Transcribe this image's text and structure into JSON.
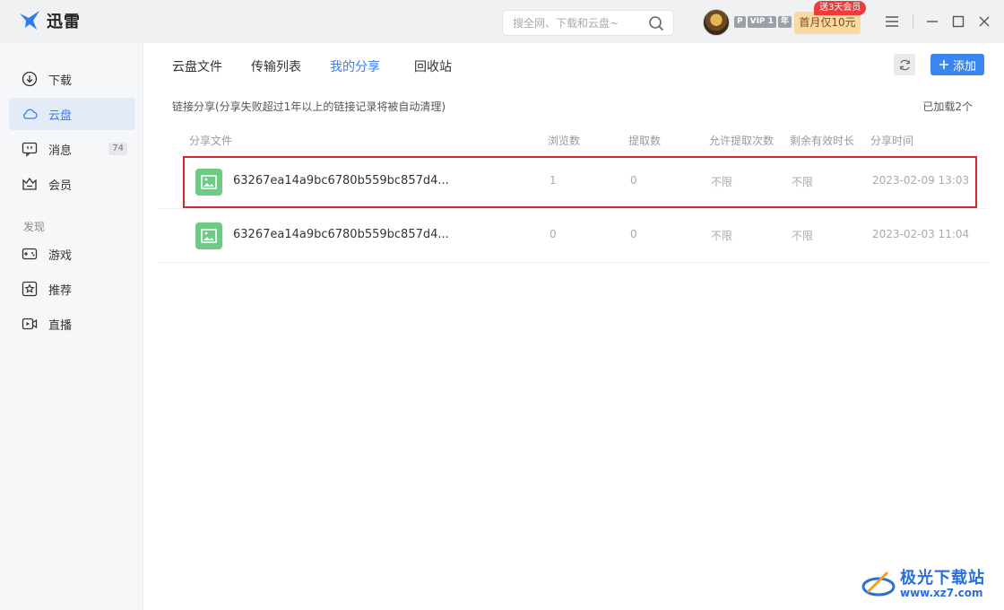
{
  "app": {
    "title": "迅雷"
  },
  "header": {
    "search_placeholder": "搜全网、下载和云盘~",
    "vip_badges": [
      "P",
      "VIP 1",
      "年"
    ],
    "promo_label": "首月仅10元",
    "promo_tag": "送3天会员"
  },
  "sidebar": {
    "items": [
      {
        "label": "下载",
        "icon": "download-icon"
      },
      {
        "label": "云盘",
        "icon": "cloud-icon",
        "active": true
      },
      {
        "label": "消息",
        "icon": "message-icon",
        "count": "74"
      },
      {
        "label": "会员",
        "icon": "crown-icon"
      }
    ],
    "section_title": "发现",
    "discover_items": [
      {
        "label": "游戏",
        "icon": "gamepad-icon"
      },
      {
        "label": "推荐",
        "icon": "star-icon"
      },
      {
        "label": "直播",
        "icon": "live-icon"
      }
    ]
  },
  "main": {
    "tabs": [
      {
        "label": "云盘文件"
      },
      {
        "label": "传输列表"
      },
      {
        "label": "我的分享",
        "active": true
      },
      {
        "label": "回收站"
      }
    ],
    "add_label": "添加",
    "notice": "链接分享(分享失败超过1年以上的链接记录将被自动清理)",
    "loaded_count": "已加载2个",
    "columns": [
      "分享文件",
      "浏览数",
      "提取数",
      "允许提取次数",
      "剩余有效时长",
      "分享时间"
    ],
    "rows": [
      {
        "name": "63267ea14a9bc6780b559bc857d4...",
        "views": "1",
        "extracts": "0",
        "allowed": "不限",
        "remaining": "不限",
        "time": "2023-02-09 13:03"
      },
      {
        "name": "63267ea14a9bc6780b559bc857d4...",
        "views": "0",
        "extracts": "0",
        "allowed": "不限",
        "remaining": "不限",
        "time": "2023-02-03 11:04"
      }
    ]
  },
  "watermark": {
    "text": "极光下载站",
    "url": "www.xz7.com"
  },
  "colors": {
    "accent": "#3a7cf0",
    "highlight_border": "#d9262b",
    "file_icon": "#6dcb83"
  }
}
